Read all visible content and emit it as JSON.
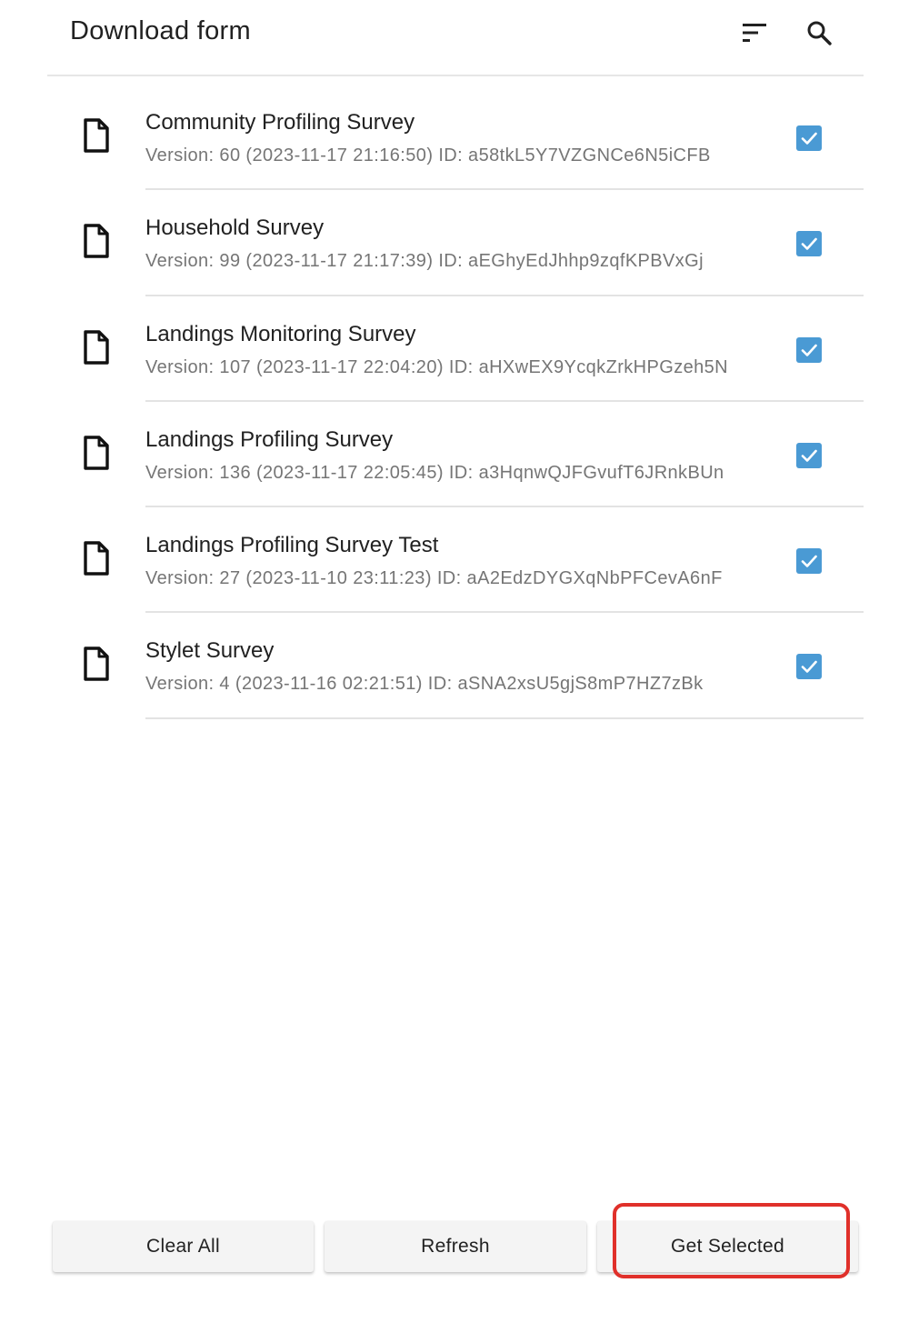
{
  "appbar": {
    "title": "Download form",
    "sort_icon": "sort-icon",
    "search_icon": "search-icon"
  },
  "forms": [
    {
      "name": "Community Profiling Survey",
      "meta": "Version: 60 (2023-11-17 21:16:50) ID: a58tkL5Y7VZGNCe6N5iCFB",
      "checked": true
    },
    {
      "name": "Household Survey",
      "meta": "Version: 99 (2023-11-17 21:17:39) ID: aEGhyEdJhhp9zqfKPBVxGj",
      "checked": true
    },
    {
      "name": "Landings Monitoring Survey",
      "meta": "Version: 107 (2023-11-17 22:04:20) ID: aHXwEX9YcqkZrkHPGzeh5N",
      "checked": true
    },
    {
      "name": "Landings Profiling Survey",
      "meta": "Version: 136 (2023-11-17 22:05:45) ID: a3HqnwQJFGvufT6JRnkBUn",
      "checked": true
    },
    {
      "name": "Landings Profiling Survey Test",
      "meta": "Version: 27 (2023-11-10 23:11:23) ID: aA2EdzDYGXqNbPFCevA6nF",
      "checked": true
    },
    {
      "name": "Stylet Survey",
      "meta": "Version: 4 (2023-11-16 02:21:51) ID: aSNA2xsU5gjS8mP7HZ7zBk",
      "checked": true
    }
  ],
  "buttons": {
    "clear_all": "Clear All",
    "refresh": "Refresh",
    "get_selected": "Get Selected"
  },
  "colors": {
    "checkbox": "#4a9ad4",
    "highlight": "#e0302a"
  }
}
